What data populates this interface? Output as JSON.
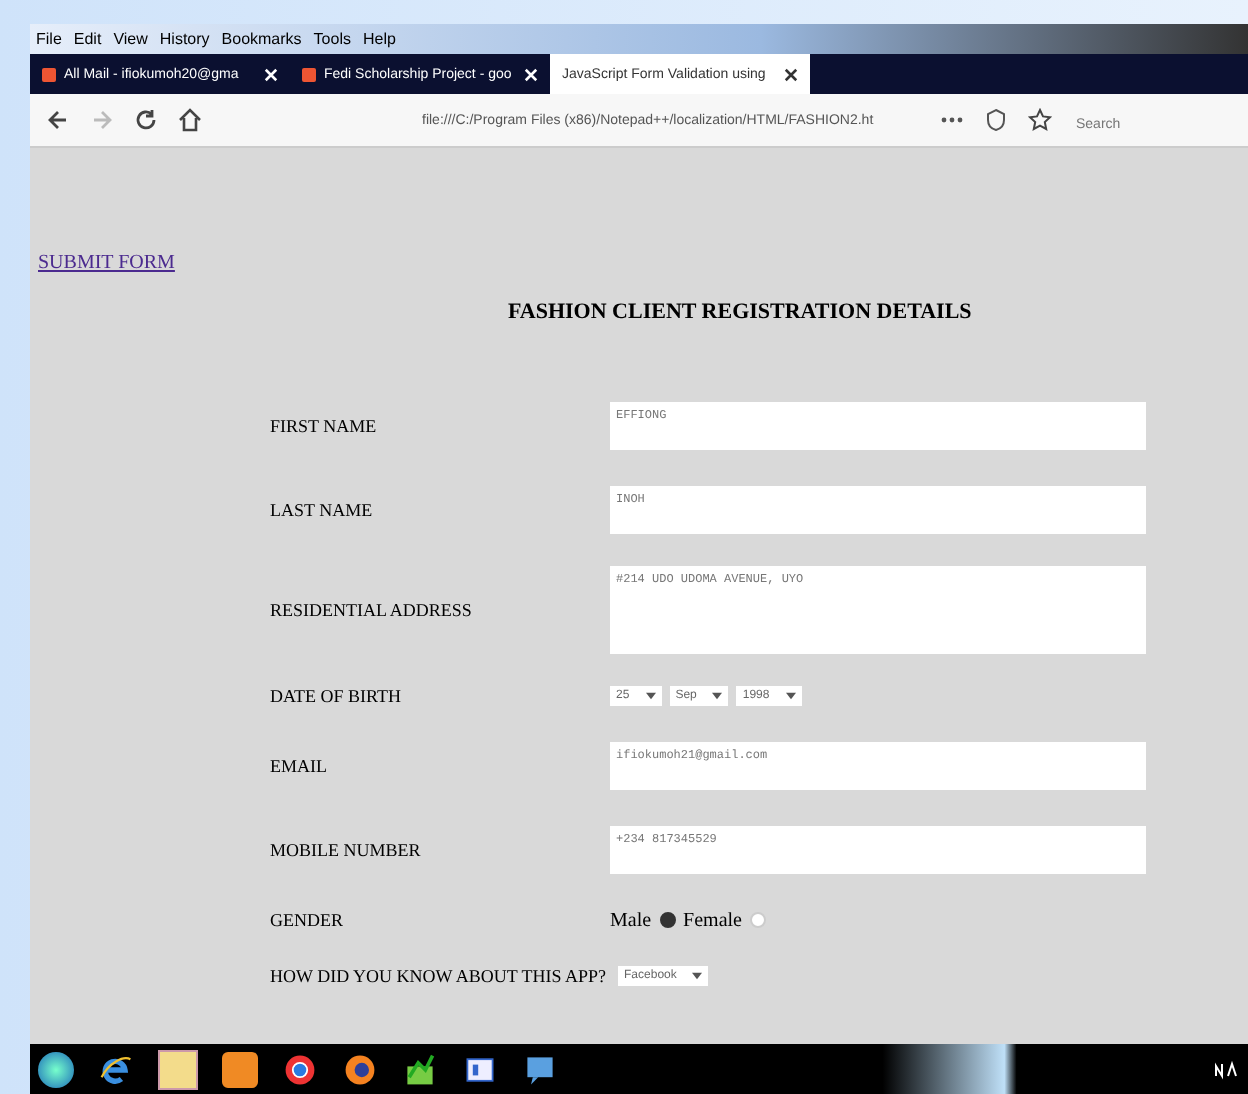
{
  "menu": [
    "File",
    "Edit",
    "View",
    "History",
    "Bookmarks",
    "Tools",
    "Help"
  ],
  "tabs": [
    {
      "label": "All Mail - ifiokumoh20@gma",
      "selected": false
    },
    {
      "label": "Fedi Scholarship Project - goo",
      "selected": false
    },
    {
      "label": "JavaScript Form Validation using",
      "selected": true
    }
  ],
  "address_bar": {
    "value": "file:///C:/Program Files (x86)/Notepad++/localization/HTML/FASHION2.ht"
  },
  "search": {
    "placeholder": "Search"
  },
  "page": {
    "link": "SUBMIT FORM",
    "heading": "FASHION CLIENT REGISTRATION DETAILS",
    "fields": [
      {
        "kind": "text",
        "label": "FIRST NAME",
        "value": "EFFIONG"
      },
      {
        "kind": "text",
        "label": "LAST NAME",
        "value": "INOH"
      },
      {
        "kind": "textarea",
        "label": "RESIDENTIAL ADDRESS",
        "value": "#214 UDO UDOMA AVENUE, UYO"
      },
      {
        "kind": "date",
        "label": "DATE OF BIRTH",
        "selects": [
          "25",
          "Sep",
          "1998"
        ]
      },
      {
        "kind": "text",
        "label": "EMAIL",
        "value": "ifiokumoh21@gmail.com"
      },
      {
        "kind": "text",
        "label": "MOBILE NUMBER",
        "value": "+234 817345529"
      },
      {
        "kind": "radio",
        "label": "GENDER",
        "options": [
          {
            "label": "Male",
            "selected": true
          },
          {
            "label": "Female",
            "selected": false
          }
        ]
      },
      {
        "kind": "select",
        "label": "HOW DID YOU KNOW ABOUT THIS APP?",
        "selects": [
          "Facebook"
        ]
      }
    ]
  }
}
